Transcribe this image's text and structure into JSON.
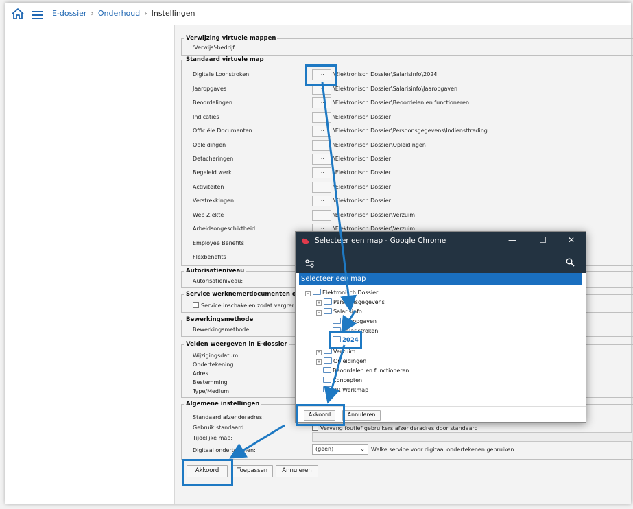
{
  "breadcrumb": {
    "root": "E-dossier",
    "middle": "Onderhoud",
    "current": "Instellingen",
    "separator": "›"
  },
  "groups": {
    "virtual_refs": {
      "legend": "Verwijzing virtuele mappen",
      "value": "'Verwijs'-bedrijf"
    },
    "standard_map": {
      "legend": "Standaard virtuele map",
      "rows": [
        {
          "label": "Digitale Loonstroken",
          "path": "\\Elektronisch Dossier\\Salarisinfo\\2024"
        },
        {
          "label": "Jaaropgaves",
          "path": "\\Elektronisch Dossier\\Salarisinfo\\Jaaropgaven"
        },
        {
          "label": "Beoordelingen",
          "path": "\\Elektronisch Dossier\\Beoordelen en functioneren"
        },
        {
          "label": "Indicaties",
          "path": "\\Elektronisch Dossier"
        },
        {
          "label": "Officiële Documenten",
          "path": "\\Elektronisch Dossier\\Persoonsgegevens\\Indiensttreding"
        },
        {
          "label": "Opleidingen",
          "path": "\\Elektronisch Dossier\\Opleidingen"
        },
        {
          "label": "Detacheringen",
          "path": "\\Elektronisch Dossier"
        },
        {
          "label": "Begeleid werk",
          "path": "\\Elektronisch Dossier"
        },
        {
          "label": "Activiteiten",
          "path": "\\Elektronisch Dossier"
        },
        {
          "label": "Verstrekkingen",
          "path": "\\Elektronisch Dossier"
        },
        {
          "label": "Web Ziekte",
          "path": "\\Elektronisch Dossier\\Verzuim"
        },
        {
          "label": "Arbeidsongeschiktheid",
          "path": "\\Elektronisch Dossier\\Verzuim"
        },
        {
          "label": "Employee Benefits",
          "path": ""
        },
        {
          "label": "Flexbenefits",
          "path": ""
        }
      ],
      "browse_label": "..."
    },
    "authorization": {
      "legend": "Autorisatieniveau",
      "label": "Autorisatieniveau:"
    },
    "service": {
      "legend": "Service werknemerdocumenten o",
      "checkbox_label": "Service inschakelen zodat vergrer"
    },
    "processing": {
      "legend": "Bewerkingsmethode",
      "label": "Bewerkingsmethode"
    },
    "fields": {
      "legend": "Velden weergeven in E-dossier",
      "items": [
        "Wijzigingsdatum",
        "Ondertekening",
        "Adres",
        "Bestemming",
        "Type/Medium"
      ]
    },
    "general": {
      "legend": "Algemene instellingen",
      "sender_label": "Standaard afzenderadres:",
      "use_default_label": "Gebruik standaard:",
      "use_default_text": "Vervang foutief gebruikers afzenderadres door standaard",
      "temp_map_label": "Tijdelijke map:",
      "digital_sign_label": "Digitaal ondertekenen:",
      "digital_sign_value": "(geen)",
      "digital_sign_hint": "Welke service voor digitaal ondertekenen gebruiken"
    }
  },
  "buttons": {
    "ok": "Akkoord",
    "apply": "Toepassen",
    "cancel": "Annuleren"
  },
  "dialog": {
    "window_title": "Selecteer een map - Google Chrome",
    "header": "Selecteer een map",
    "tree": {
      "root": "Elektronisch Dossier",
      "n1": "Persoonsgegevens",
      "n2": "Salarisinfo",
      "n2a": "Jaaropgaven",
      "n2b": "Salaristroken",
      "n2c": "2024",
      "n3": "Verzuim",
      "n4": "Opleidingen",
      "n5": "Beoordelen en functioneren",
      "n6": "Concepten",
      "n7": "HR Werkmap"
    },
    "ok": "Akkoord",
    "cancel": "Annuleren"
  },
  "colors": {
    "accent": "#1e79c3",
    "link": "#1f67b3",
    "dialog_titlebar": "#233341",
    "tree_header": "#1a6fbf"
  },
  "icons": [
    "home-icon",
    "hamburger-menu-icon",
    "chrome-logo-icon",
    "minimize-icon",
    "maximize-icon",
    "close-icon",
    "site-settings-icon",
    "zoom-icon",
    "folder-icon",
    "expand-icon"
  ]
}
